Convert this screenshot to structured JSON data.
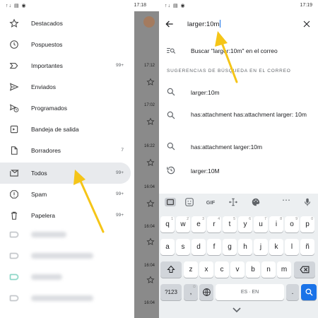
{
  "left": {
    "status": {
      "icons": "↑↓ ▤ ◉",
      "time": "17:18"
    },
    "drawer_items": [
      {
        "label": "Destacados",
        "icon": "star-icon",
        "count": ""
      },
      {
        "label": "Pospuestos",
        "icon": "clock-icon",
        "count": ""
      },
      {
        "label": "Importantes",
        "icon": "label-important-icon",
        "count": "99+"
      },
      {
        "label": "Enviados",
        "icon": "send-icon",
        "count": ""
      },
      {
        "label": "Programados",
        "icon": "scheduled-send-icon",
        "count": ""
      },
      {
        "label": "Bandeja de salida",
        "icon": "outbox-icon",
        "count": ""
      },
      {
        "label": "Borradores",
        "icon": "draft-icon",
        "count": "7"
      },
      {
        "label": "Todos",
        "icon": "all-mail-icon",
        "count": "99+",
        "selected": true
      },
      {
        "label": "Spam",
        "icon": "spam-icon",
        "count": "99+"
      },
      {
        "label": "Papelera",
        "icon": "trash-icon",
        "count": "99+"
      }
    ],
    "mail_times": [
      "17:12",
      "17:02",
      "16:22",
      "16:04",
      "16:04",
      "16:04",
      "16:04"
    ]
  },
  "right": {
    "status": {
      "icons": "↑↓ ▤ ◉",
      "time": "17:19"
    },
    "search_query": "larger:10m",
    "search_in_mail": "Buscar \"larger:10m\" en el correo",
    "suggestions_header": "SUGERENCIAS DE BÚSQUEDA EN EL CORREO",
    "suggestions": [
      {
        "text": "larger:10m",
        "icon": "search-icon"
      },
      {
        "text": "has:attachment has:attachment larger: 10m",
        "icon": "search-icon"
      },
      {
        "text": "has:attachment larger:10m",
        "icon": "search-icon"
      },
      {
        "text": "larger:10M",
        "icon": "history-icon"
      }
    ],
    "keyboard": {
      "toolbar": [
        "GIF"
      ],
      "row1": [
        {
          "k": "q",
          "h": "1"
        },
        {
          "k": "w",
          "h": "2"
        },
        {
          "k": "e",
          "h": "3"
        },
        {
          "k": "r",
          "h": "4"
        },
        {
          "k": "t",
          "h": "5"
        },
        {
          "k": "y",
          "h": "6"
        },
        {
          "k": "u",
          "h": "7"
        },
        {
          "k": "i",
          "h": "8"
        },
        {
          "k": "o",
          "h": "9"
        },
        {
          "k": "p",
          "h": "0"
        }
      ],
      "row2": [
        "a",
        "s",
        "d",
        "f",
        "g",
        "h",
        "j",
        "k",
        "l",
        "ñ"
      ],
      "row3": [
        "z",
        "x",
        "c",
        "v",
        "b",
        "n",
        "m"
      ],
      "numbers": "?123",
      "comma": ",",
      "space_label": "ES · EN",
      "period": "."
    }
  },
  "colors": {
    "accent": "#1a73e8",
    "arrow": "#f5c518",
    "selected_bg": "#e8eaed"
  }
}
